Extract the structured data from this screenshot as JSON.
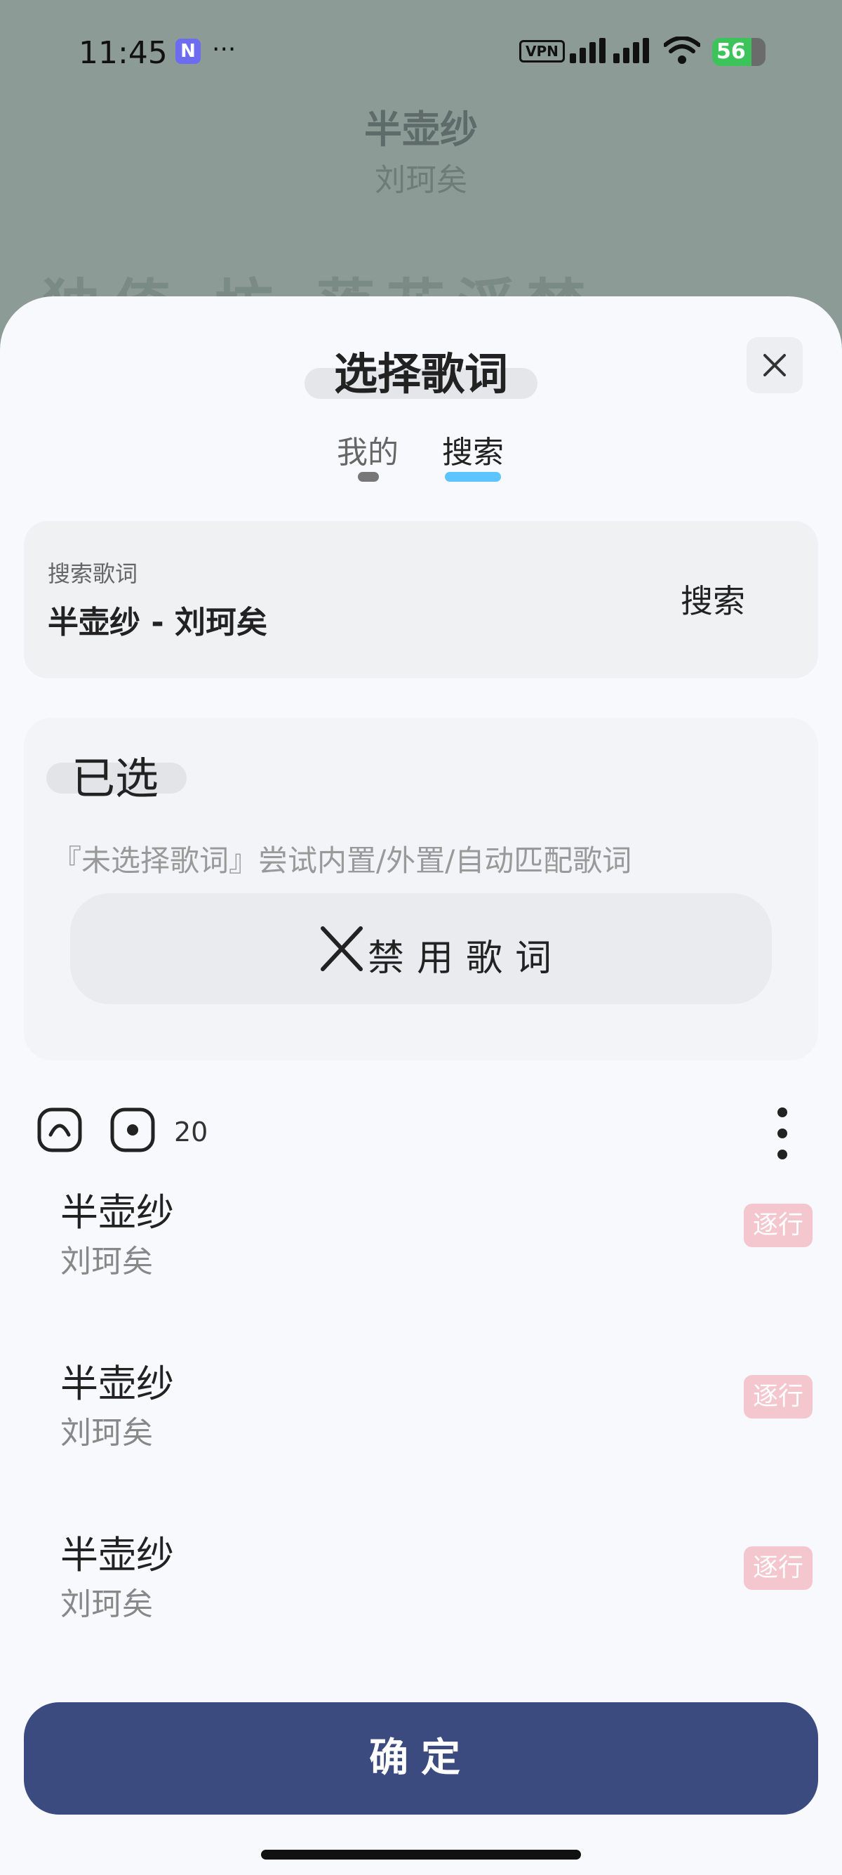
{
  "status": {
    "time": "11:45",
    "app_badge": "N",
    "more": "···",
    "vpn": "VPN",
    "battery": "56"
  },
  "background": {
    "song_title": "半壶纱",
    "artist": "刘珂矣",
    "lyric_partial": "独倚  坊  落花浮梦"
  },
  "sheet": {
    "title": "选择歌词",
    "close_icon": "close-icon",
    "tabs": [
      {
        "label": "我的",
        "active": false
      },
      {
        "label": "搜索",
        "active": true
      }
    ],
    "search": {
      "label": "搜索歌词",
      "value": "半壶纱 - 刘珂矣",
      "button": "搜索"
    },
    "selected": {
      "title": "已选",
      "description": "『未选择歌词』尝试内置/外置/自动匹配歌词",
      "disable_button": "禁用歌词"
    },
    "toolbar": {
      "count": "20"
    },
    "results": [
      {
        "title": "半壶纱",
        "artist": "刘珂矣",
        "badge": "逐行"
      },
      {
        "title": "半壶纱",
        "artist": "刘珂矣",
        "badge": "逐行"
      },
      {
        "title": "半壶纱",
        "artist": "刘珂矣",
        "badge": "逐行"
      }
    ],
    "confirm": "确定"
  },
  "colors": {
    "accent": "#5cc5ff",
    "confirm_bg": "#3b4b7f",
    "badge_bg": "#f4c7cf"
  }
}
